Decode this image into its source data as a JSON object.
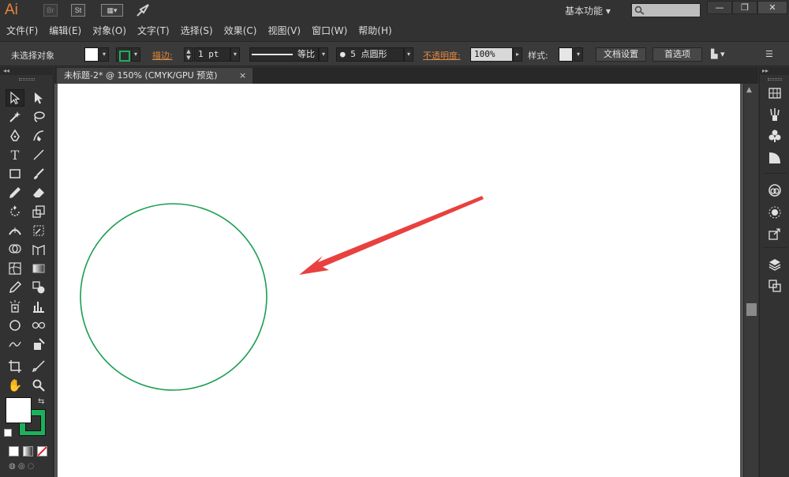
{
  "app": {
    "logo": "Ai",
    "bridge_label": "Br",
    "stock_label": "St",
    "workspace": "基本功能",
    "workspace_arrow": "▾",
    "window_controls": {
      "minimize": "—",
      "restore": "❐",
      "close": "✕"
    }
  },
  "menu": {
    "items": [
      "文件(F)",
      "编辑(E)",
      "对象(O)",
      "文字(T)",
      "选择(S)",
      "效果(C)",
      "视图(V)",
      "窗口(W)",
      "帮助(H)"
    ]
  },
  "control_bar": {
    "selection_status": "未选择对象",
    "stroke_label": "描边:",
    "stroke_weight": "1 pt",
    "stroke_profile": "等比",
    "brush": "5 点圆形",
    "opacity_label": "不透明度:",
    "opacity_value": "100%",
    "style_label": "样式:",
    "doc_setup_button": "文档设置",
    "preferences_button": "首选项"
  },
  "document": {
    "tab_title": "未标题-2* @ 150% (CMYK/GPU 预览)",
    "tab_close": "×"
  },
  "colors": {
    "accent_orange": "#e0893f",
    "stroke_green": "#1db05c",
    "arrow_red": "#e8413f"
  },
  "canvas_objects": {
    "circle": {
      "stroke_color": "#1a9e52"
    },
    "arrow": {
      "color": "#e8413f"
    }
  },
  "icons": {
    "selection": "selection-tool-icon",
    "direct_selection": "direct-selection-tool-icon",
    "magic_wand": "magic-wand-icon",
    "lasso": "lasso-icon",
    "pen": "pen-tool-icon",
    "curvature": "curvature-tool-icon",
    "type": "T",
    "line": "line-tool-icon",
    "rectangle": "rectangle-tool-icon",
    "paintbrush": "paintbrush-icon",
    "pencil": "pencil-icon",
    "eraser": "eraser-icon",
    "rotate": "rotate-icon",
    "scale": "scale-icon",
    "hand": "✋",
    "zoom": "zoom-icon"
  }
}
